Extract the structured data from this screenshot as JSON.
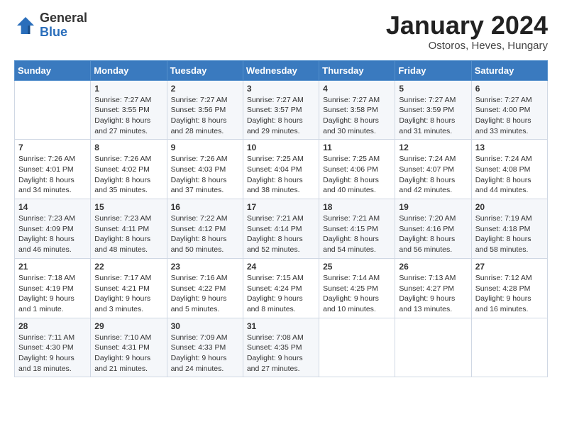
{
  "header": {
    "logo_general": "General",
    "logo_blue": "Blue",
    "month": "January 2024",
    "location": "Ostoros, Heves, Hungary"
  },
  "weekdays": [
    "Sunday",
    "Monday",
    "Tuesday",
    "Wednesday",
    "Thursday",
    "Friday",
    "Saturday"
  ],
  "weeks": [
    [
      {
        "day": "",
        "sunrise": "",
        "sunset": "",
        "daylight": ""
      },
      {
        "day": "1",
        "sunrise": "Sunrise: 7:27 AM",
        "sunset": "Sunset: 3:55 PM",
        "daylight": "Daylight: 8 hours and 27 minutes."
      },
      {
        "day": "2",
        "sunrise": "Sunrise: 7:27 AM",
        "sunset": "Sunset: 3:56 PM",
        "daylight": "Daylight: 8 hours and 28 minutes."
      },
      {
        "day": "3",
        "sunrise": "Sunrise: 7:27 AM",
        "sunset": "Sunset: 3:57 PM",
        "daylight": "Daylight: 8 hours and 29 minutes."
      },
      {
        "day": "4",
        "sunrise": "Sunrise: 7:27 AM",
        "sunset": "Sunset: 3:58 PM",
        "daylight": "Daylight: 8 hours and 30 minutes."
      },
      {
        "day": "5",
        "sunrise": "Sunrise: 7:27 AM",
        "sunset": "Sunset: 3:59 PM",
        "daylight": "Daylight: 8 hours and 31 minutes."
      },
      {
        "day": "6",
        "sunrise": "Sunrise: 7:27 AM",
        "sunset": "Sunset: 4:00 PM",
        "daylight": "Daylight: 8 hours and 33 minutes."
      }
    ],
    [
      {
        "day": "7",
        "sunrise": "Sunrise: 7:26 AM",
        "sunset": "Sunset: 4:01 PM",
        "daylight": "Daylight: 8 hours and 34 minutes."
      },
      {
        "day": "8",
        "sunrise": "Sunrise: 7:26 AM",
        "sunset": "Sunset: 4:02 PM",
        "daylight": "Daylight: 8 hours and 35 minutes."
      },
      {
        "day": "9",
        "sunrise": "Sunrise: 7:26 AM",
        "sunset": "Sunset: 4:03 PM",
        "daylight": "Daylight: 8 hours and 37 minutes."
      },
      {
        "day": "10",
        "sunrise": "Sunrise: 7:25 AM",
        "sunset": "Sunset: 4:04 PM",
        "daylight": "Daylight: 8 hours and 38 minutes."
      },
      {
        "day": "11",
        "sunrise": "Sunrise: 7:25 AM",
        "sunset": "Sunset: 4:06 PM",
        "daylight": "Daylight: 8 hours and 40 minutes."
      },
      {
        "day": "12",
        "sunrise": "Sunrise: 7:24 AM",
        "sunset": "Sunset: 4:07 PM",
        "daylight": "Daylight: 8 hours and 42 minutes."
      },
      {
        "day": "13",
        "sunrise": "Sunrise: 7:24 AM",
        "sunset": "Sunset: 4:08 PM",
        "daylight": "Daylight: 8 hours and 44 minutes."
      }
    ],
    [
      {
        "day": "14",
        "sunrise": "Sunrise: 7:23 AM",
        "sunset": "Sunset: 4:09 PM",
        "daylight": "Daylight: 8 hours and 46 minutes."
      },
      {
        "day": "15",
        "sunrise": "Sunrise: 7:23 AM",
        "sunset": "Sunset: 4:11 PM",
        "daylight": "Daylight: 8 hours and 48 minutes."
      },
      {
        "day": "16",
        "sunrise": "Sunrise: 7:22 AM",
        "sunset": "Sunset: 4:12 PM",
        "daylight": "Daylight: 8 hours and 50 minutes."
      },
      {
        "day": "17",
        "sunrise": "Sunrise: 7:21 AM",
        "sunset": "Sunset: 4:14 PM",
        "daylight": "Daylight: 8 hours and 52 minutes."
      },
      {
        "day": "18",
        "sunrise": "Sunrise: 7:21 AM",
        "sunset": "Sunset: 4:15 PM",
        "daylight": "Daylight: 8 hours and 54 minutes."
      },
      {
        "day": "19",
        "sunrise": "Sunrise: 7:20 AM",
        "sunset": "Sunset: 4:16 PM",
        "daylight": "Daylight: 8 hours and 56 minutes."
      },
      {
        "day": "20",
        "sunrise": "Sunrise: 7:19 AM",
        "sunset": "Sunset: 4:18 PM",
        "daylight": "Daylight: 8 hours and 58 minutes."
      }
    ],
    [
      {
        "day": "21",
        "sunrise": "Sunrise: 7:18 AM",
        "sunset": "Sunset: 4:19 PM",
        "daylight": "Daylight: 9 hours and 1 minute."
      },
      {
        "day": "22",
        "sunrise": "Sunrise: 7:17 AM",
        "sunset": "Sunset: 4:21 PM",
        "daylight": "Daylight: 9 hours and 3 minutes."
      },
      {
        "day": "23",
        "sunrise": "Sunrise: 7:16 AM",
        "sunset": "Sunset: 4:22 PM",
        "daylight": "Daylight: 9 hours and 5 minutes."
      },
      {
        "day": "24",
        "sunrise": "Sunrise: 7:15 AM",
        "sunset": "Sunset: 4:24 PM",
        "daylight": "Daylight: 9 hours and 8 minutes."
      },
      {
        "day": "25",
        "sunrise": "Sunrise: 7:14 AM",
        "sunset": "Sunset: 4:25 PM",
        "daylight": "Daylight: 9 hours and 10 minutes."
      },
      {
        "day": "26",
        "sunrise": "Sunrise: 7:13 AM",
        "sunset": "Sunset: 4:27 PM",
        "daylight": "Daylight: 9 hours and 13 minutes."
      },
      {
        "day": "27",
        "sunrise": "Sunrise: 7:12 AM",
        "sunset": "Sunset: 4:28 PM",
        "daylight": "Daylight: 9 hours and 16 minutes."
      }
    ],
    [
      {
        "day": "28",
        "sunrise": "Sunrise: 7:11 AM",
        "sunset": "Sunset: 4:30 PM",
        "daylight": "Daylight: 9 hours and 18 minutes."
      },
      {
        "day": "29",
        "sunrise": "Sunrise: 7:10 AM",
        "sunset": "Sunset: 4:31 PM",
        "daylight": "Daylight: 9 hours and 21 minutes."
      },
      {
        "day": "30",
        "sunrise": "Sunrise: 7:09 AM",
        "sunset": "Sunset: 4:33 PM",
        "daylight": "Daylight: 9 hours and 24 minutes."
      },
      {
        "day": "31",
        "sunrise": "Sunrise: 7:08 AM",
        "sunset": "Sunset: 4:35 PM",
        "daylight": "Daylight: 9 hours and 27 minutes."
      },
      {
        "day": "",
        "sunrise": "",
        "sunset": "",
        "daylight": ""
      },
      {
        "day": "",
        "sunrise": "",
        "sunset": "",
        "daylight": ""
      },
      {
        "day": "",
        "sunrise": "",
        "sunset": "",
        "daylight": ""
      }
    ]
  ]
}
